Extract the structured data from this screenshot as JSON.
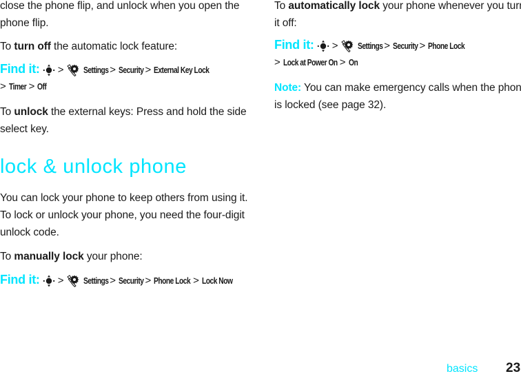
{
  "left": {
    "intro_line1": "close the phone flip, and unlock when you open the",
    "intro_line2": "phone flip.",
    "turn_off": {
      "prefix": "To ",
      "bold": "turn off",
      "suffix": " the automatic lock feature:"
    },
    "find1": {
      "label": "Find it:",
      "path": [
        "Settings",
        "Security",
        "External Key Lock"
      ],
      "path2": [
        "Timer",
        "Off"
      ]
    },
    "unlock": {
      "prefix": "To ",
      "bold": "unlock",
      "suffix_line1": " the external keys: Press and hold the side",
      "line2": "select key."
    },
    "heading": "lock & unlock phone",
    "body_line1": "You can lock your phone to keep others from using it.",
    "body_line2": "To lock or unlock your phone, you need the four-digit",
    "body_line3": "unlock code.",
    "manual": {
      "prefix": "To ",
      "bold": "manually lock",
      "suffix": " your phone:"
    },
    "find2": {
      "label": "Find it:",
      "path": [
        "Settings",
        "Security",
        "Phone Lock",
        "Lock Now"
      ]
    }
  },
  "right": {
    "auto": {
      "prefix": "To ",
      "bold": "automatically lock",
      "suffix": " your phone whenever you turn",
      "line2": "it off:"
    },
    "find3": {
      "label": "Find it:",
      "path": [
        "Settings",
        "Security",
        "Phone Lock"
      ],
      "path2": [
        "Lock at Power On",
        "On"
      ]
    },
    "note": {
      "label": "Note:",
      "line1": " You can make emergency calls when the phone",
      "line2": "is locked (see page 32)."
    }
  },
  "footer": {
    "section": "basics",
    "page": "23"
  },
  "colors": {
    "accent": "#00e5ff",
    "text": "#1a1a1a"
  }
}
